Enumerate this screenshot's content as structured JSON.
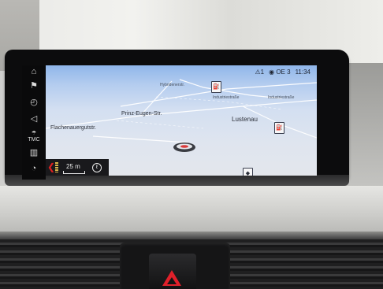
{
  "status_bar": {
    "warning": "⚠1",
    "station": "◉ OE 3",
    "time": "11:34"
  },
  "map": {
    "labels": {
      "street_top": "Hybridenerstr.",
      "street_right": "Industriestraße",
      "street_far_right": "Industriestraße",
      "street_left": "Prinz-Eugen-Str.",
      "street_far_left": "Flachenauergutstr.",
      "town": "Lustenau"
    }
  },
  "scale": {
    "value": "25 m",
    "compass_glyph": "ℓ"
  },
  "icons": {
    "home": "home-icon",
    "flag": "flag-icon",
    "clock": "clock-icon",
    "speaker": "speaker-icon",
    "tmc": "TMC",
    "map_book": "map-icon",
    "speed": "gauge-icon"
  }
}
